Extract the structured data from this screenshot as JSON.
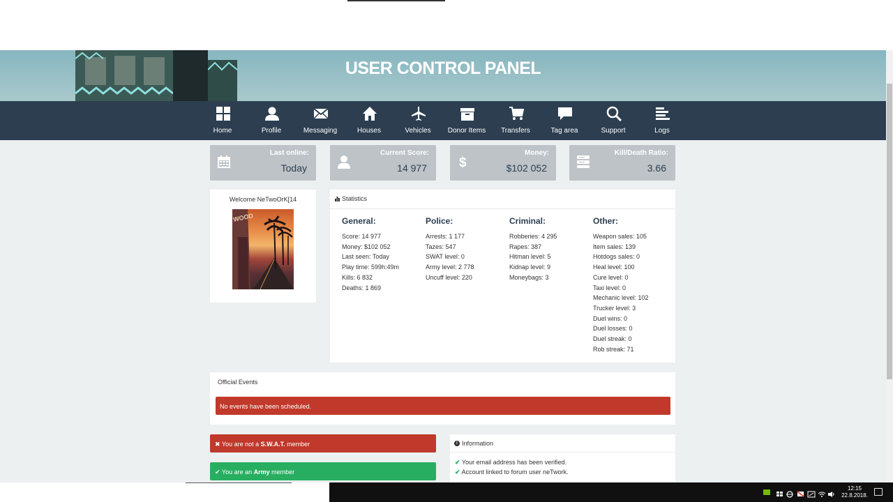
{
  "banner": {
    "title": "USER CONTROL PANEL"
  },
  "nav": [
    {
      "label": "Home",
      "icon": "grid-icon"
    },
    {
      "label": "Profile",
      "icon": "user-icon"
    },
    {
      "label": "Messaging",
      "icon": "envelope-icon"
    },
    {
      "label": "Houses",
      "icon": "house-icon"
    },
    {
      "label": "Vehicles",
      "icon": "airplane-icon"
    },
    {
      "label": "Donor Items",
      "icon": "archive-icon"
    },
    {
      "label": "Transfers",
      "icon": "cart-icon"
    },
    {
      "label": "Tag area",
      "icon": "comment-icon"
    },
    {
      "label": "Support",
      "icon": "search-icon"
    },
    {
      "label": "Logs",
      "icon": "list-icon"
    }
  ],
  "stats": [
    {
      "label": "Last online:",
      "value": "Today",
      "icon": "calendar-icon"
    },
    {
      "label": "Current Score:",
      "value": "14 977",
      "icon": "user-icon"
    },
    {
      "label": "Money:",
      "value": "$102 052",
      "icon": "dollar-icon"
    },
    {
      "label": "Kill/Death Ratio:",
      "value": "3.66",
      "icon": "server-icon"
    }
  ],
  "welcome": {
    "text": "Welcome NeTwoOrK[14"
  },
  "statistics": {
    "title": "Statistics",
    "general": {
      "title": "General:",
      "rows": [
        "Score: 14 977",
        "Money: $102 052",
        "Last seen: Today",
        "Play time: 599h:49m",
        "Kills: 6 832",
        "Deaths: 1 869"
      ]
    },
    "police": {
      "title": "Police:",
      "rows": [
        "Arrests: 1 177",
        "Tazes: 547",
        "SWAT level: 0",
        "Army level: 2 778",
        "Uncuff level: 220"
      ]
    },
    "criminal": {
      "title": "Criminal:",
      "rows": [
        "Robberies: 4 295",
        "Rapes: 387",
        "Hitman level: 5",
        "Kidnap level: 9",
        "Moneybags: 3"
      ]
    },
    "other": {
      "title": "Other:",
      "rows": [
        "Weapon sales: 105",
        "Item sales: 139",
        "Hotdogs sales: 0",
        "Heal level: 100",
        "Cure level: 0",
        "Taxi level: 0",
        "Mechanic level: 102",
        "Trucker level: 3",
        "Duel wins: 0",
        "Duel losses: 0",
        "Duel streak: 0",
        "Rob streak: 71"
      ]
    }
  },
  "events": {
    "title": "Official Events",
    "alert": "No events have been scheduled."
  },
  "membership": {
    "swat_prefix": "You are not a ",
    "swat_strong": "S.W.A.T.",
    "swat_suffix": " member",
    "army_prefix": "You are an ",
    "army_strong": "Army",
    "army_suffix": " member"
  },
  "information": {
    "title": "Information",
    "lines": [
      "Your email address has been verified.",
      "Account linked to forum user neTwork."
    ]
  },
  "taskbar": {
    "time": "12:15",
    "date": "22.8.2018."
  },
  "colors": {
    "navbar": "#2c3e50",
    "danger": "#c0392b",
    "success": "#27ae60",
    "stat_box": "#bdc3c7"
  }
}
